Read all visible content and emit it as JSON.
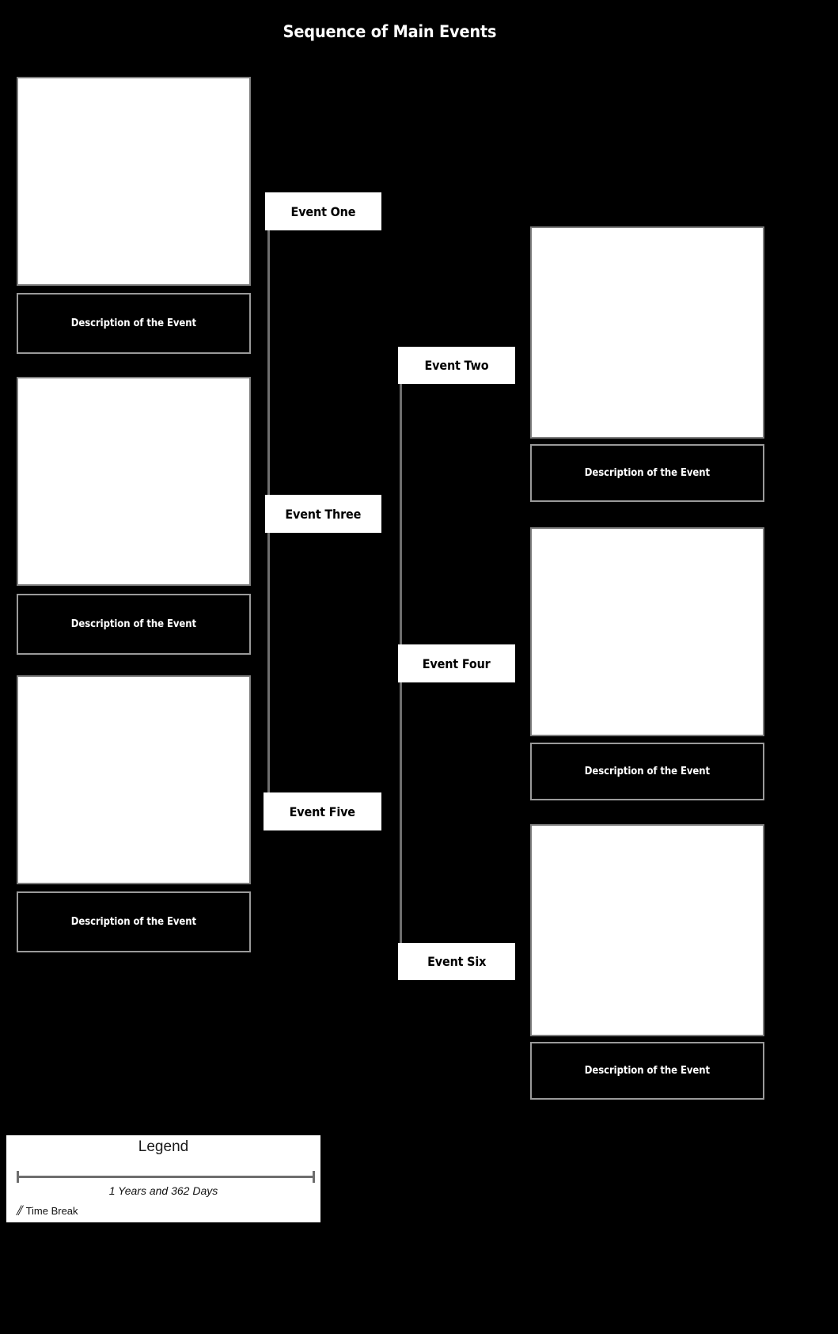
{
  "title": "Sequence of Main Events",
  "background_color": "#000000",
  "box_border_color": "#7d7d7d",
  "desc_border_color": "#9a9a9a",
  "rail_color": "#6e6e6e",
  "events": [
    {
      "label": "Event One",
      "description": "Description of the Event"
    },
    {
      "label": "Event Two",
      "description": "Description of the Event"
    },
    {
      "label": "Event Three",
      "description": "Description of the Event"
    },
    {
      "label": "Event Four",
      "description": "Description of the Event"
    },
    {
      "label": "Event Five",
      "description": "Description of the Event"
    },
    {
      "label": "Event Six",
      "description": "Description of the Event"
    }
  ],
  "legend": {
    "title": "Legend",
    "scale_label": "1 Years and 362 Days",
    "time_break_label": "Time Break",
    "time_break_glyph": "//"
  }
}
